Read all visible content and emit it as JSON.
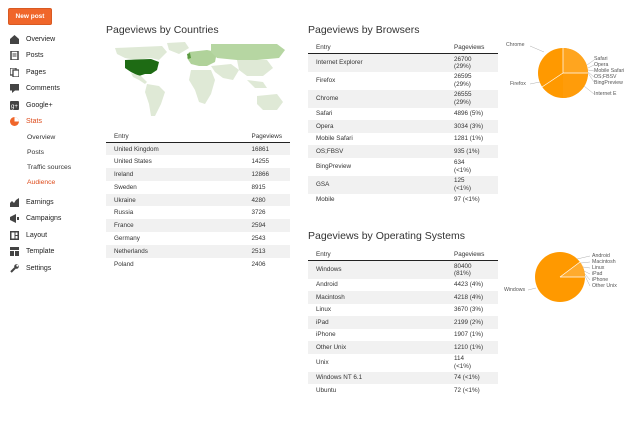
{
  "sidebar": {
    "new_post": "New post",
    "items": [
      {
        "label": "Overview",
        "icon": "overview-icon"
      },
      {
        "label": "Posts",
        "icon": "posts-icon"
      },
      {
        "label": "Pages",
        "icon": "pages-icon"
      },
      {
        "label": "Comments",
        "icon": "comments-icon"
      },
      {
        "label": "Google+",
        "icon": "google-plus-icon"
      },
      {
        "label": "Stats",
        "icon": "stats-icon"
      }
    ],
    "stats_sub": [
      "Overview",
      "Posts",
      "Traffic sources",
      "Audience"
    ],
    "items2": [
      {
        "label": "Earnings",
        "icon": "earnings-icon"
      },
      {
        "label": "Campaigns",
        "icon": "campaigns-icon"
      },
      {
        "label": "Layout",
        "icon": "layout-icon"
      },
      {
        "label": "Template",
        "icon": "template-icon"
      },
      {
        "label": "Settings",
        "icon": "settings-icon"
      }
    ],
    "accent_color": "#f0662a"
  },
  "countries": {
    "title": "Pageviews by Countries",
    "col_entry": "Entry",
    "col_views": "Pageviews",
    "rows": [
      [
        "United Kingdom",
        "16861"
      ],
      [
        "United States",
        "14255"
      ],
      [
        "Ireland",
        "12866"
      ],
      [
        "Sweden",
        "8915"
      ],
      [
        "Ukraine",
        "4280"
      ],
      [
        "Russia",
        "3726"
      ],
      [
        "France",
        "2594"
      ],
      [
        "Germany",
        "2543"
      ],
      [
        "Netherlands",
        "2513"
      ],
      [
        "Poland",
        "2406"
      ]
    ]
  },
  "browsers": {
    "title": "Pageviews by Browsers",
    "col_entry": "Entry",
    "col_views": "Pageviews",
    "rows": [
      [
        "Internet Explorer",
        "26700",
        "(29%)"
      ],
      [
        "Firefox",
        "26595",
        "(29%)"
      ],
      [
        "Chrome",
        "26555",
        "(29%)"
      ],
      [
        "Safari",
        "4896 (5%)",
        ""
      ],
      [
        "Opera",
        "3034 (3%)",
        ""
      ],
      [
        "Mobile Safari",
        "1281 (1%)",
        ""
      ],
      [
        "OS;FBSV",
        "935 (1%)",
        ""
      ],
      [
        "BingPreview",
        "634",
        "(<1%)"
      ],
      [
        "GSA",
        "125",
        "(<1%)"
      ],
      [
        "Mobile",
        "97 (<1%)",
        ""
      ]
    ],
    "pie_labels": [
      "Chrome",
      "Safari",
      "Opera",
      "Mobile Safari",
      "OS;FBSV",
      "BingPreview",
      "Internet E",
      "Firefox"
    ]
  },
  "os": {
    "title": "Pageviews by Operating Systems",
    "col_entry": "Entry",
    "col_views": "Pageviews",
    "rows": [
      [
        "Windows",
        "80400",
        "(81%)"
      ],
      [
        "Android",
        "4423 (4%)",
        ""
      ],
      [
        "Macintosh",
        "4218 (4%)",
        ""
      ],
      [
        "Linux",
        "3670 (3%)",
        ""
      ],
      [
        "iPad",
        "2199 (2%)",
        ""
      ],
      [
        "iPhone",
        "1907 (1%)",
        ""
      ],
      [
        "Other Unix",
        "1210 (1%)",
        ""
      ],
      [
        "Unix",
        "114",
        "(<1%)"
      ],
      [
        "Windows NT 6.1",
        "74 (<1%)",
        ""
      ],
      [
        "Ubuntu",
        "72 (<1%)",
        ""
      ]
    ],
    "pie_labels": [
      "Android",
      "Macintosh",
      "Linux",
      "iPad",
      "iPhone",
      "Other Unix",
      "Windows"
    ]
  },
  "pie_color": "#ff9900"
}
